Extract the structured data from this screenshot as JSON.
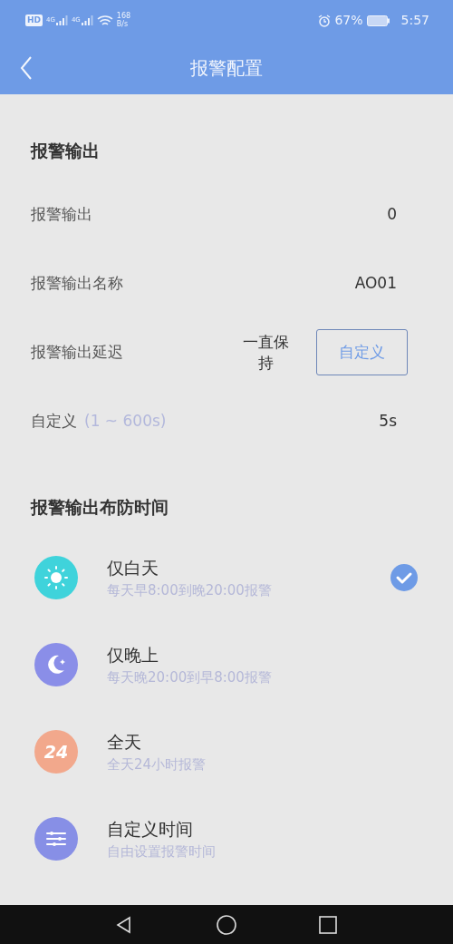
{
  "status_bar": {
    "hd": "HD",
    "networks": [
      "4G",
      "4G"
    ],
    "speed": "168",
    "speed_unit": "B/s",
    "battery": "67%",
    "time": "5:57"
  },
  "header": {
    "title": "报警配置"
  },
  "output_section": {
    "title": "报警输出",
    "rows": [
      {
        "kind": "value",
        "label": "报警输出",
        "value": "0"
      },
      {
        "kind": "value",
        "label": "报警输出名称",
        "value": "AO01"
      },
      {
        "kind": "choice",
        "label": "报警输出延迟",
        "value": "一直保持",
        "button": "自定义"
      },
      {
        "kind": "value",
        "label": "自定义",
        "hint": "(1 ~ 600s)",
        "value": "5s"
      }
    ]
  },
  "schedule_section": {
    "title": "报警输出布防时间",
    "options": [
      {
        "kind": "sun",
        "color": "#3fd3db",
        "title": "仅白天",
        "subtitle": "每天早8:00到晚20:00报警",
        "selected": true
      },
      {
        "kind": "moon",
        "color": "#8a8ee8",
        "title": "仅晚上",
        "subtitle": "每天晚20:00到早8:00报警",
        "selected": false
      },
      {
        "kind": "badge",
        "color": "#f2a88c",
        "badge": "24",
        "title": "全天",
        "subtitle": "全天24小时报警",
        "selected": false
      },
      {
        "kind": "sliders",
        "color": "#878fe6",
        "title": "自定义时间",
        "subtitle": "自由设置报警时间",
        "selected": false
      }
    ]
  }
}
